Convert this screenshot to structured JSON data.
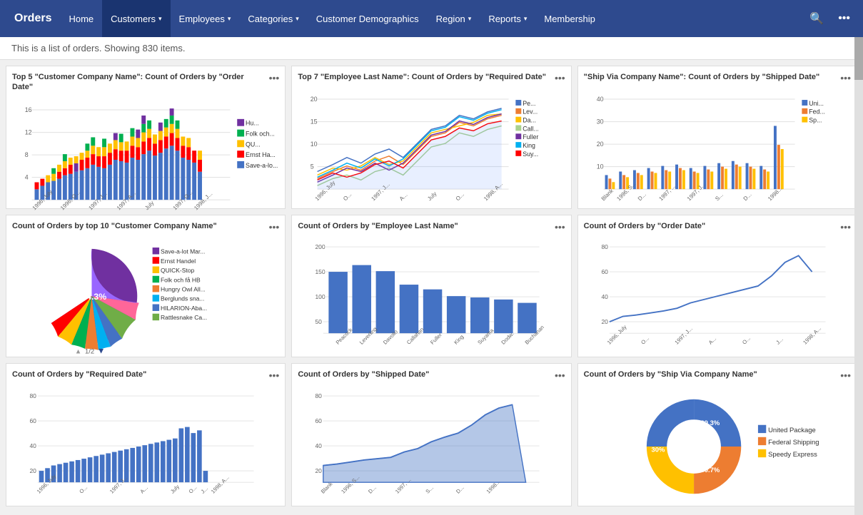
{
  "navbar": {
    "brand": "Orders",
    "items": [
      {
        "label": "Home",
        "active": false,
        "has_caret": false
      },
      {
        "label": "Customers",
        "active": true,
        "has_caret": true
      },
      {
        "label": "Employees",
        "active": false,
        "has_caret": true
      },
      {
        "label": "Categories",
        "active": false,
        "has_caret": true
      },
      {
        "label": "Customer Demographics",
        "active": false,
        "has_caret": false
      },
      {
        "label": "Region",
        "active": false,
        "has_caret": true
      },
      {
        "label": "Reports",
        "active": false,
        "has_caret": true
      },
      {
        "label": "Membership",
        "active": false,
        "has_caret": false
      }
    ]
  },
  "subtitle": "This is a list of orders. Showing 830 items.",
  "charts": [
    {
      "id": "chart1",
      "title": "Top 5 \"Customer Company Name\": Count of Orders by \"Order Date\"",
      "type": "bar_stacked",
      "legend": [
        {
          "label": "Hu...",
          "color": "#7030a0"
        },
        {
          "label": "Folk och...",
          "color": "#00b050"
        },
        {
          "label": "QU...",
          "color": "#ffc000"
        },
        {
          "label": "Ernst Ha...",
          "color": "#ff0000"
        },
        {
          "label": "Save-a-lo...",
          "color": "#4472c4"
        }
      ]
    },
    {
      "id": "chart2",
      "title": "Top 7 \"Employee Last Name\": Count of Orders by \"Required Date\"",
      "type": "line_multi",
      "legend": [
        {
          "label": "Pe...",
          "color": "#4472c4"
        },
        {
          "label": "Lev...",
          "color": "#ed7d31"
        },
        {
          "label": "Da...",
          "color": "#ffc000"
        },
        {
          "label": "Call...",
          "color": "#a9d18e"
        },
        {
          "label": "Fuller",
          "color": "#7030a0"
        },
        {
          "label": "King",
          "color": "#00b0f0"
        },
        {
          "label": "Suy...",
          "color": "#ff0000"
        }
      ]
    },
    {
      "id": "chart3",
      "title": "\"Ship Via Company Name\": Count of Orders by \"Shipped Date\"",
      "type": "bar_grouped",
      "legend": [
        {
          "label": "Uni...",
          "color": "#4472c4"
        },
        {
          "label": "Fed...",
          "color": "#ed7d31"
        },
        {
          "label": "Sp...",
          "color": "#ffc000"
        }
      ]
    },
    {
      "id": "chart4",
      "title": "Count of Orders by top 10 \"Customer Company Name\"",
      "type": "pie",
      "legend": [
        {
          "label": "Save-a-lot Mar...",
          "color": "#7030a0"
        },
        {
          "label": "Ernst Handel",
          "color": "#ff0000"
        },
        {
          "label": "QUICK-Stop",
          "color": "#ffc000"
        },
        {
          "label": "Folk och få HB",
          "color": "#00b050"
        },
        {
          "label": "Hungry Owl All...",
          "color": "#7030a0"
        },
        {
          "label": "Berglunds sna...",
          "color": "#00b0f0"
        },
        {
          "label": "HILARION-Aba...",
          "color": "#4472c4"
        },
        {
          "label": "Rattlesnake Ca...",
          "color": "#70ad47"
        }
      ],
      "center_label": "74.3%",
      "pagination": "1/2"
    },
    {
      "id": "chart5",
      "title": "Count of Orders by \"Employee Last Name\"",
      "type": "bar_single",
      "y_max": 200,
      "x_labels": [
        "Peacock",
        "Leverling",
        "Davolio",
        "Callahan",
        "Fuller",
        "King",
        "Suyama",
        "Dodw.",
        "Buchanan"
      ]
    },
    {
      "id": "chart6",
      "title": "Count of Orders by \"Order Date\"",
      "type": "line_single",
      "y_max": 80
    },
    {
      "id": "chart7",
      "title": "Count of Orders by \"Required Date\"",
      "type": "bar_single",
      "y_max": 80
    },
    {
      "id": "chart8",
      "title": "Count of Orders by \"Shipped Date\"",
      "type": "area_single",
      "y_max": 80
    },
    {
      "id": "chart9",
      "title": "Count of Orders by \"Ship Via Company Name\"",
      "type": "donut",
      "legend": [
        {
          "label": "United Package",
          "color": "#4472c4"
        },
        {
          "label": "Federal Shipping",
          "color": "#ed7d31"
        },
        {
          "label": "Speedy Express",
          "color": "#ffc000"
        }
      ],
      "segments": [
        {
          "label": "39.3%",
          "color": "#4472c4",
          "percent": 39.3
        },
        {
          "label": "30.7%",
          "color": "#ed7d31",
          "percent": 30.7
        },
        {
          "label": "30%",
          "color": "#ffc000",
          "percent": 30
        }
      ]
    }
  ]
}
